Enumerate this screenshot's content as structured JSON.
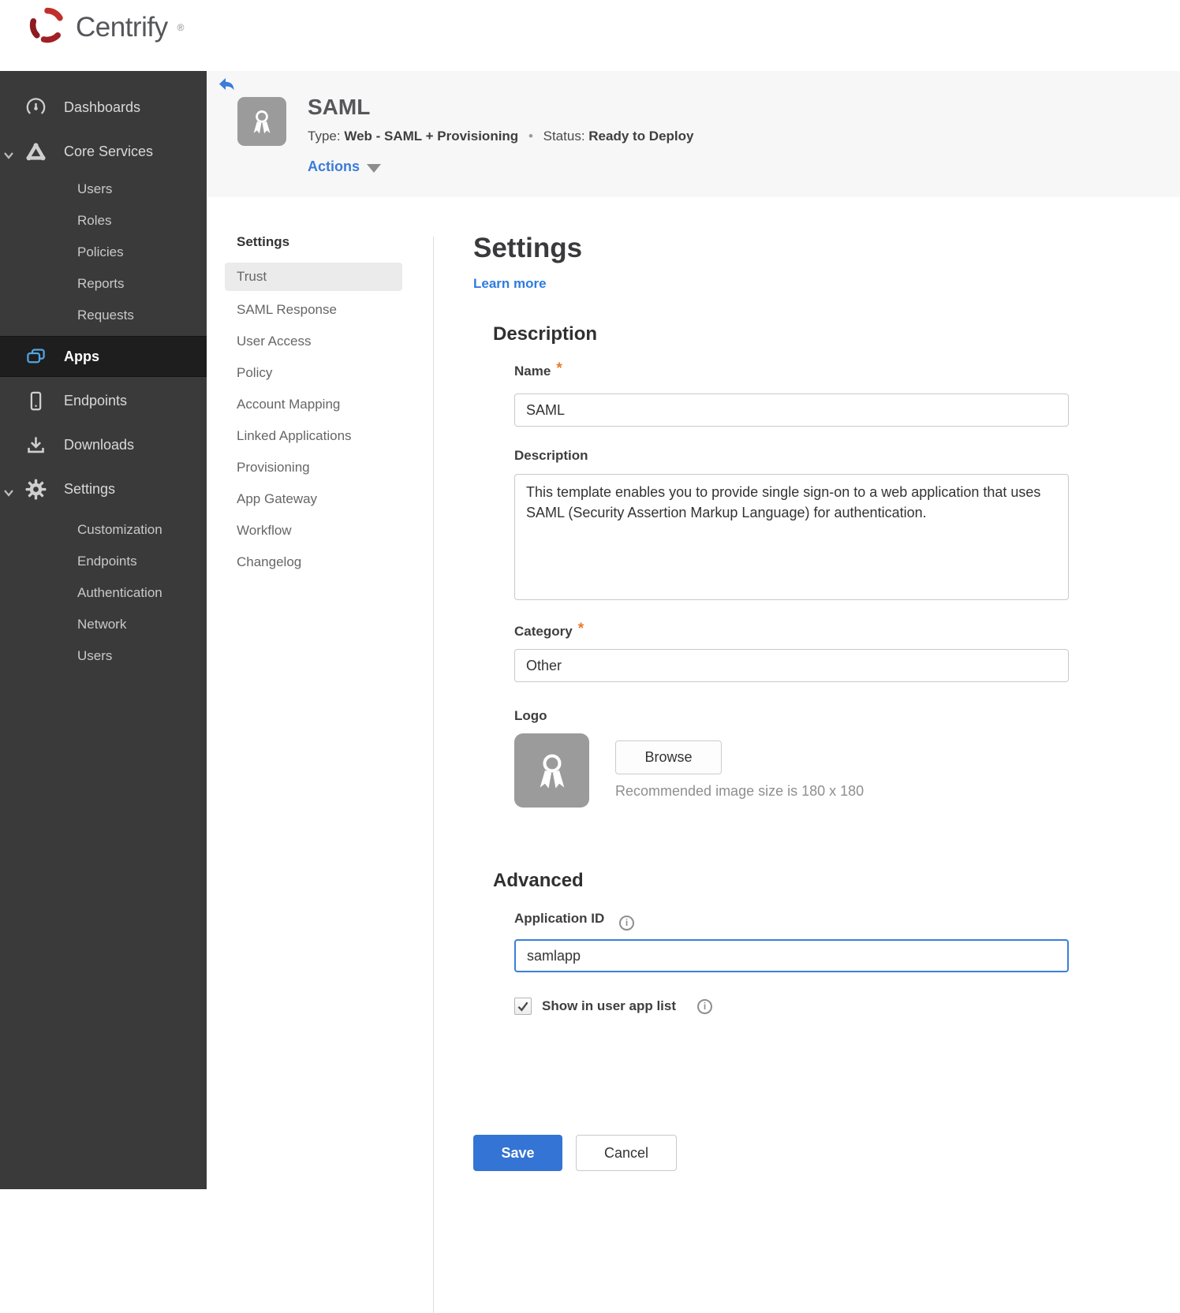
{
  "brand": {
    "name": "Centrify",
    "reg": "®"
  },
  "colors": {
    "accent_blue": "#3a7cd8",
    "save_blue": "#3474d4",
    "status_red": "#a21e22",
    "sidebar_bg": "#3a3a3b",
    "apps_icon_blue": "#54a4e0",
    "asterisk_orange": "#e87b2e"
  },
  "sidebar": {
    "items": [
      {
        "label": "Dashboards",
        "icon": "gauge-icon"
      },
      {
        "label": "Core Services",
        "icon": "core-services-icon",
        "expanded": true
      },
      {
        "label": "Users"
      },
      {
        "label": "Roles"
      },
      {
        "label": "Policies"
      },
      {
        "label": "Reports"
      },
      {
        "label": "Requests"
      },
      {
        "label": "Apps",
        "icon": "apps-icon",
        "active": true
      },
      {
        "label": "Endpoints",
        "icon": "endpoint-icon"
      },
      {
        "label": "Downloads",
        "icon": "download-icon"
      },
      {
        "label": "Settings",
        "icon": "gear-icon",
        "expanded": true
      },
      {
        "label": "Customization"
      },
      {
        "label": "Endpoints"
      },
      {
        "label": "Authentication"
      },
      {
        "label": "Network"
      },
      {
        "label": "Users"
      }
    ]
  },
  "app_header": {
    "title": "SAML",
    "type_label": "Type:",
    "type_value": "Web - SAML + Provisioning",
    "separator": "•",
    "status_label": "Status:",
    "status_value": "Ready to Deploy",
    "actions_label": "Actions"
  },
  "subnav": {
    "header": "Settings",
    "items": [
      {
        "label": "Trust",
        "active": true
      },
      {
        "label": "SAML Response"
      },
      {
        "label": "User Access"
      },
      {
        "label": "Policy"
      },
      {
        "label": "Account Mapping"
      },
      {
        "label": "Linked Applications"
      },
      {
        "label": "Provisioning"
      },
      {
        "label": "App Gateway"
      },
      {
        "label": "Workflow"
      },
      {
        "label": "Changelog"
      }
    ]
  },
  "main": {
    "title": "Settings",
    "learn_more": "Learn more",
    "description_section": "Description",
    "name_label": "Name",
    "required_marker": "*",
    "name_value": "SAML",
    "description_label": "Description",
    "description_value": "This template enables you to provide single sign-on to a web application that uses SAML (Security Assertion Markup Language) for authentication.",
    "category_label": "Category",
    "category_value": "Other",
    "logo_label": "Logo",
    "browse_button": "Browse",
    "logo_hint": "Recommended image size is 180 x 180",
    "advanced_section": "Advanced",
    "application_id_label": "Application ID",
    "application_id_value": "samlapp",
    "info_glyph": "i",
    "show_in_user_app_list_label": "Show in user app list",
    "save_button": "Save",
    "cancel_button": "Cancel"
  }
}
